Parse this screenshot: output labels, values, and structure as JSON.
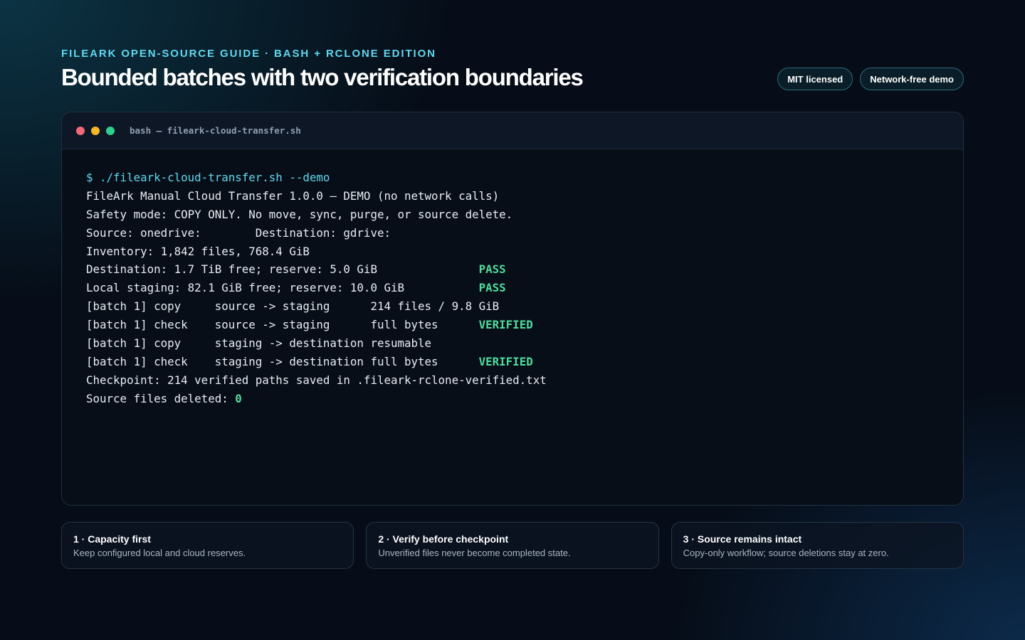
{
  "header": {
    "eyebrow": "FILEARK OPEN-SOURCE GUIDE · BASH + RCLONE EDITION",
    "title": "Bounded batches with two verification boundaries",
    "badges": [
      "MIT licensed",
      "Network-free demo"
    ]
  },
  "terminal": {
    "window_title": "bash — fileark-cloud-transfer.sh",
    "colors": {
      "prompt": "#5fd8ee",
      "status_ok": "#4fdc9c",
      "dot_close": "#f16a7c",
      "dot_minimize": "#f5b927",
      "dot_maximize": "#2ecf8f"
    },
    "lines": [
      {
        "text": "$ ./fileark-cloud-transfer.sh --demo",
        "status": ""
      },
      {
        "text": "FileArk Manual Cloud Transfer 1.0.0 — DEMO (no network calls)",
        "status": ""
      },
      {
        "text": "Safety mode: COPY ONLY. No move, sync, purge, or source delete.",
        "status": ""
      },
      {
        "text": "Source: onedrive:        Destination: gdrive:",
        "status": ""
      },
      {
        "text": "Inventory: 1,842 files, 768.4 GiB",
        "status": ""
      },
      {
        "text": "Destination: 1.7 TiB free; reserve: 5.0 GiB               ",
        "status": "PASS"
      },
      {
        "text": "Local staging: 82.1 GiB free; reserve: 10.0 GiB           ",
        "status": "PASS"
      },
      {
        "text": "[batch 1] copy     source -> staging      214 files / 9.8 GiB",
        "status": ""
      },
      {
        "text": "[batch 1] check    source -> staging      full bytes      ",
        "status": "VERIFIED"
      },
      {
        "text": "[batch 1] copy     staging -> destination resumable",
        "status": ""
      },
      {
        "text": "[batch 1] check    staging -> destination full bytes      ",
        "status": "VERIFIED"
      },
      {
        "text": "Checkpoint: 214 verified paths saved in .fileark-rclone-verified.txt",
        "status": ""
      },
      {
        "text": "Source files deleted: ",
        "status": "0"
      }
    ]
  },
  "cards": [
    {
      "title": "1 · Capacity first",
      "description": "Keep configured local and cloud reserves."
    },
    {
      "title": "2 · Verify before checkpoint",
      "description": "Unverified files never become completed state."
    },
    {
      "title": "3 · Source remains intact",
      "description": "Copy-only workflow; source deletions stay at zero."
    }
  ]
}
